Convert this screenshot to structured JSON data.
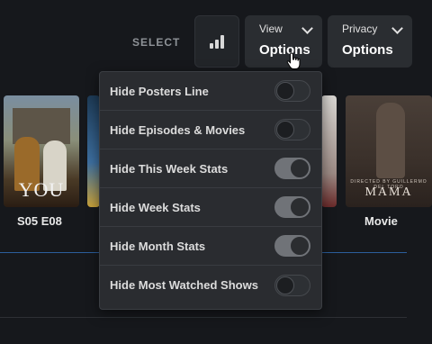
{
  "toolbar": {
    "select_label": "SELECT",
    "stats_icon": "bar-chart-icon",
    "view": {
      "top": "View",
      "bottom": "Options"
    },
    "privacy": {
      "top": "Privacy",
      "bottom": "Options"
    }
  },
  "posters": {
    "left_title": "YOU",
    "left_caption": "S05 E08",
    "right_byline": "DIRECTED BY GUILLERMO DEL TORO",
    "right_title": "MAMA",
    "right_caption": "Movie"
  },
  "options": [
    {
      "label": "Hide Posters Line",
      "on": false
    },
    {
      "label": "Hide Episodes & Movies",
      "on": false
    },
    {
      "label": "Hide This Week Stats",
      "on": true
    },
    {
      "label": "Hide Week Stats",
      "on": true
    },
    {
      "label": "Hide Month Stats",
      "on": true
    },
    {
      "label": "Hide Most Watched Shows",
      "on": false
    }
  ],
  "colors": {
    "accent_line": "#2b5e9c",
    "toggle_on": "#707378",
    "menu_bg": "#2a2c30"
  }
}
